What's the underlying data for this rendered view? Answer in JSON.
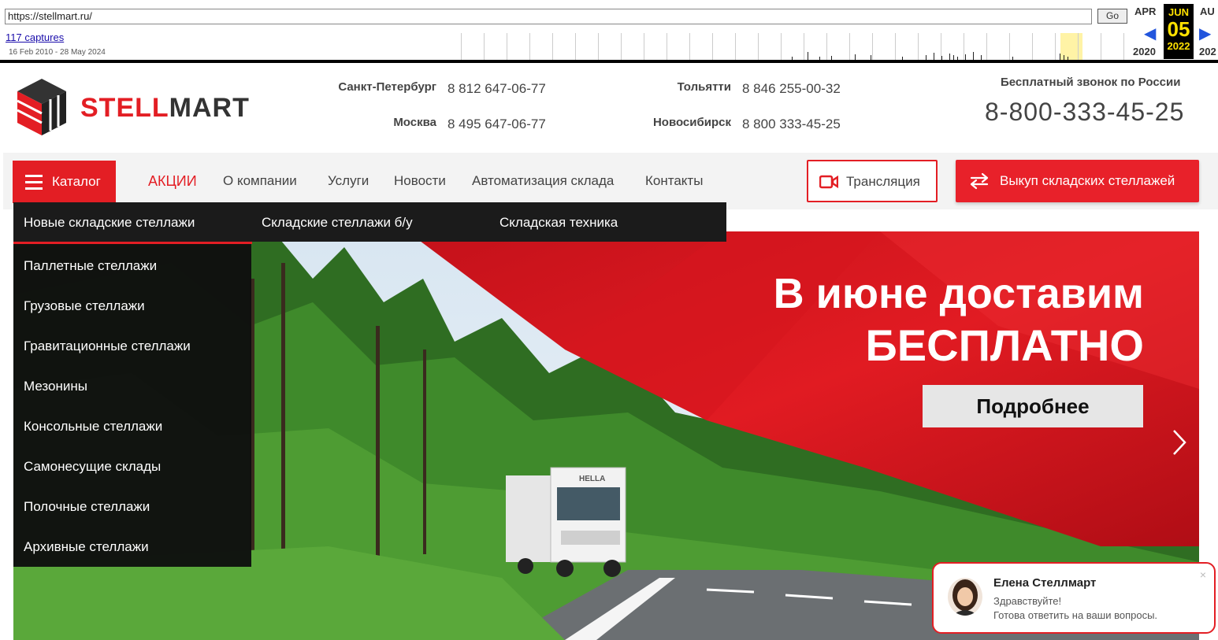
{
  "wayback": {
    "url": "https://stellmart.ru/",
    "go_label": "Go",
    "captures": "117 captures",
    "range": "16 Feb 2010 - 28 May 2024",
    "prev_month": "APR",
    "cur_month": "JUN",
    "next_month": "AU",
    "cur_day": "05",
    "prev_year": "2020",
    "cur_year": "2022",
    "next_year": "202"
  },
  "header": {
    "logo_text_red": "STELL",
    "logo_text_dark": "MART",
    "phones": [
      {
        "city": "Санкт-Петербург",
        "number": "8 812 647-06-77"
      },
      {
        "city": "Москва",
        "number": "8 495 647-06-77"
      },
      {
        "city": "Тольятти",
        "number": "8 846 255-00-32"
      },
      {
        "city": "Новосибирск",
        "number": "8 800 333-45-25"
      }
    ],
    "free_label": "Бесплатный звонок по России",
    "free_number": "8-800-333-45-25"
  },
  "nav": {
    "catalog": "Каталог",
    "links": [
      "АКЦИИ",
      "О компании",
      "Услуги",
      "Новости",
      "Автоматизация склада",
      "Контакты"
    ],
    "stream": "Трансляция",
    "buyback": "Выкуп складских стеллажей"
  },
  "catalog_menu": {
    "tabs": [
      "Новые складские стеллажи",
      "Складские стеллажи б/у",
      "Складская техника"
    ],
    "items": [
      "Паллетные стеллажи",
      "Грузовые стеллажи",
      "Гравитационные стеллажи",
      "Мезонины",
      "Консольные стеллажи",
      "Самонесущие склады",
      "Полочные стеллажи",
      "Архивные стеллажи"
    ]
  },
  "hero": {
    "line1": "В июне доставим",
    "line2": "БЕСПЛАТНО",
    "button": "Подробнее",
    "truck_label": "HELLA"
  },
  "chat": {
    "name": "Елена Стеллмарт",
    "line1": "Здравствуйте!",
    "line2": "Готова ответить на ваши вопросы.",
    "close": "×"
  },
  "colors": {
    "brand_red": "#e31e24",
    "dark": "#1b1b1b"
  }
}
